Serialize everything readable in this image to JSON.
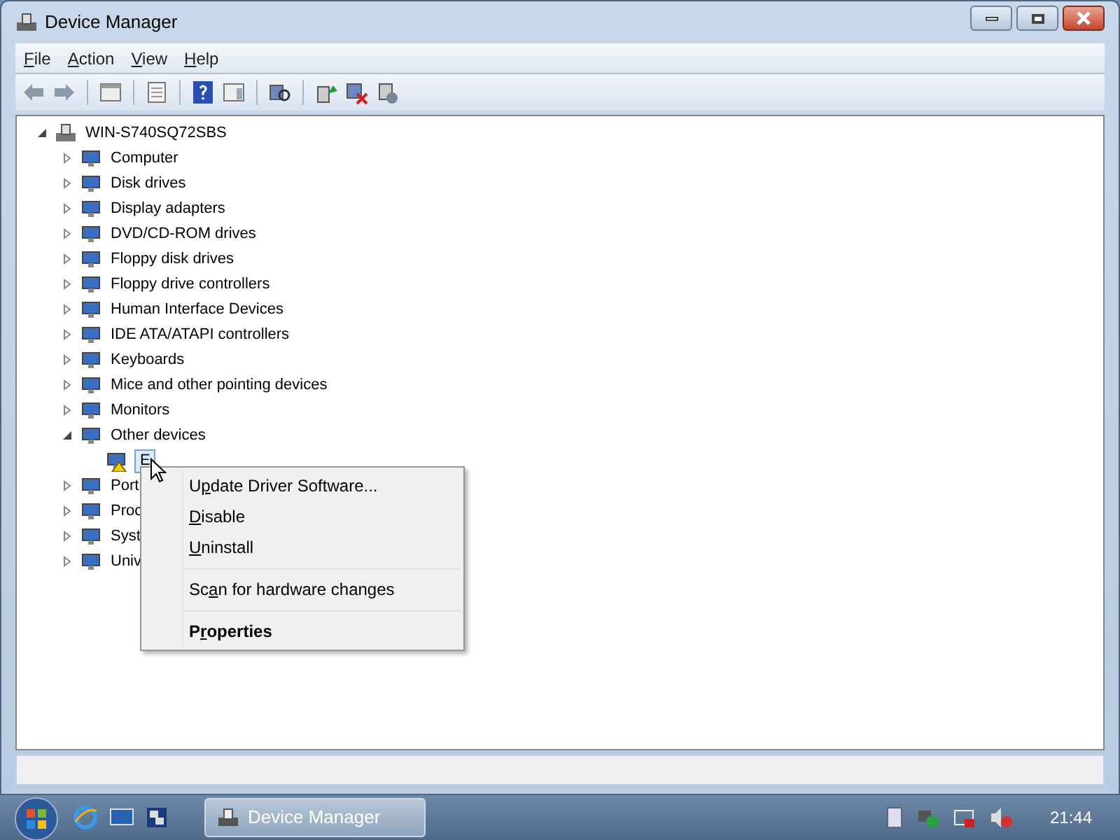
{
  "window": {
    "title": "Device Manager"
  },
  "menu_bar": [
    {
      "key": "F",
      "post": "ile"
    },
    {
      "key": "A",
      "post": "ction"
    },
    {
      "key": "V",
      "post": "iew"
    },
    {
      "key": "H",
      "post": "elp"
    }
  ],
  "tree": {
    "label": "WIN-S740SQ72SBS",
    "expanded": true,
    "selected": false,
    "children": [
      {
        "label": "Computer",
        "expanded": false,
        "selected": false
      },
      {
        "label": "Disk drives",
        "expanded": false,
        "selected": false
      },
      {
        "label": "Display adapters",
        "expanded": false,
        "selected": false
      },
      {
        "label": "DVD/CD-ROM drives",
        "expanded": false,
        "selected": false
      },
      {
        "label": "Floppy disk drives",
        "expanded": false,
        "selected": false
      },
      {
        "label": "Floppy drive controllers",
        "expanded": false,
        "selected": false
      },
      {
        "label": "Human Interface Devices",
        "expanded": false,
        "selected": false
      },
      {
        "label": "IDE ATA/ATAPI controllers",
        "expanded": false,
        "selected": false
      },
      {
        "label": "Keyboards",
        "expanded": false,
        "selected": false
      },
      {
        "label": "Mice and other pointing devices",
        "expanded": false,
        "selected": false
      },
      {
        "label": "Monitors",
        "expanded": false,
        "selected": false
      },
      {
        "label": "Other devices",
        "expanded": true,
        "selected": false,
        "children": [
          {
            "label": "E",
            "selected": true
          }
        ]
      },
      {
        "label": "Port",
        "expanded": false,
        "selected": false
      },
      {
        "label": "Proc",
        "expanded": false,
        "selected": false
      },
      {
        "label": "Syst",
        "expanded": false,
        "selected": false
      },
      {
        "label": "Univ",
        "expanded": false,
        "selected": false
      }
    ]
  },
  "context_menu": [
    {
      "kind": "item",
      "pre": "U",
      "key": "p",
      "post": "date Driver Software...",
      "bold": false
    },
    {
      "kind": "item",
      "key": "D",
      "post": "isable",
      "bold": false
    },
    {
      "kind": "item",
      "key": "U",
      "post": "ninstall",
      "bold": false
    },
    {
      "kind": "separator"
    },
    {
      "kind": "item",
      "pre": "Sc",
      "key": "a",
      "post": "n for hardware changes",
      "bold": false
    },
    {
      "kind": "separator"
    },
    {
      "kind": "item",
      "pre": "P",
      "key": "r",
      "post": "operties",
      "bold": true
    }
  ],
  "taskbar": {
    "task": "Device Manager",
    "clock": "21:44"
  }
}
